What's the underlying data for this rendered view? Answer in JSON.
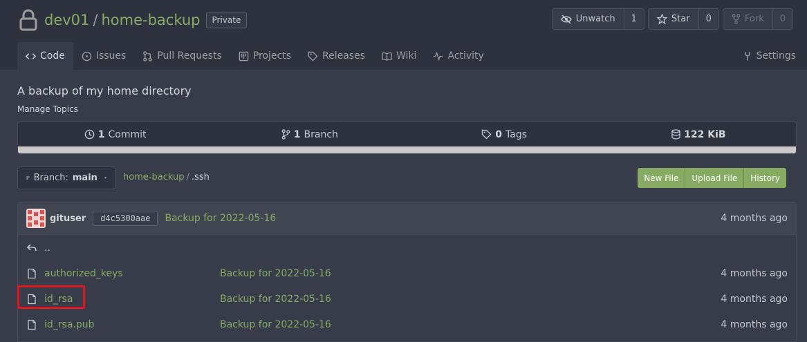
{
  "repo": {
    "owner": "dev01",
    "separator": "/",
    "name": "home-backup",
    "visibility": "Private"
  },
  "actions": {
    "watch": {
      "label": "Unwatch",
      "count": "1"
    },
    "star": {
      "label": "Star",
      "count": "0"
    },
    "fork": {
      "label": "Fork",
      "count": "0"
    }
  },
  "tabs": [
    {
      "label": "Code",
      "icon": "code-icon",
      "active": true
    },
    {
      "label": "Issues",
      "icon": "issues-icon"
    },
    {
      "label": "Pull Requests",
      "icon": "pull-request-icon"
    },
    {
      "label": "Projects",
      "icon": "projects-icon"
    },
    {
      "label": "Releases",
      "icon": "tag-icon"
    },
    {
      "label": "Wiki",
      "icon": "book-icon"
    },
    {
      "label": "Activity",
      "icon": "pulse-icon"
    }
  ],
  "settings_label": "Settings",
  "description": "A backup of my home directory",
  "manage_topics": "Manage Topics",
  "stats": {
    "commits_count": "1",
    "commits_label": "Commit",
    "branches_count": "1",
    "branches_label": "Branch",
    "tags_count": "0",
    "tags_label": "Tags",
    "size": "122 KiB"
  },
  "branch": {
    "prefix": "Branch:",
    "name": "main"
  },
  "breadcrumb": {
    "root": "home-backup",
    "sep": "/",
    "current": ".ssh"
  },
  "file_actions": {
    "new_file": "New File",
    "upload_file": "Upload File",
    "history": "History"
  },
  "latest_commit": {
    "user": "gituser",
    "sha": "d4c5300aae",
    "message": "Backup for 2022-05-16",
    "time": "4 months ago"
  },
  "parent_dir": "..",
  "files": [
    {
      "name": "authorized_keys",
      "message": "Backup for 2022-05-16",
      "time": "4 months ago"
    },
    {
      "name": "id_rsa",
      "message": "Backup for 2022-05-16",
      "time": "4 months ago"
    },
    {
      "name": "id_rsa.pub",
      "message": "Backup for 2022-05-16",
      "time": "4 months ago"
    }
  ],
  "colors": {
    "accent": "#87ab63",
    "highlight": "#e1161d",
    "header_bg": "#2e323e",
    "body_bg": "#383c4a"
  }
}
